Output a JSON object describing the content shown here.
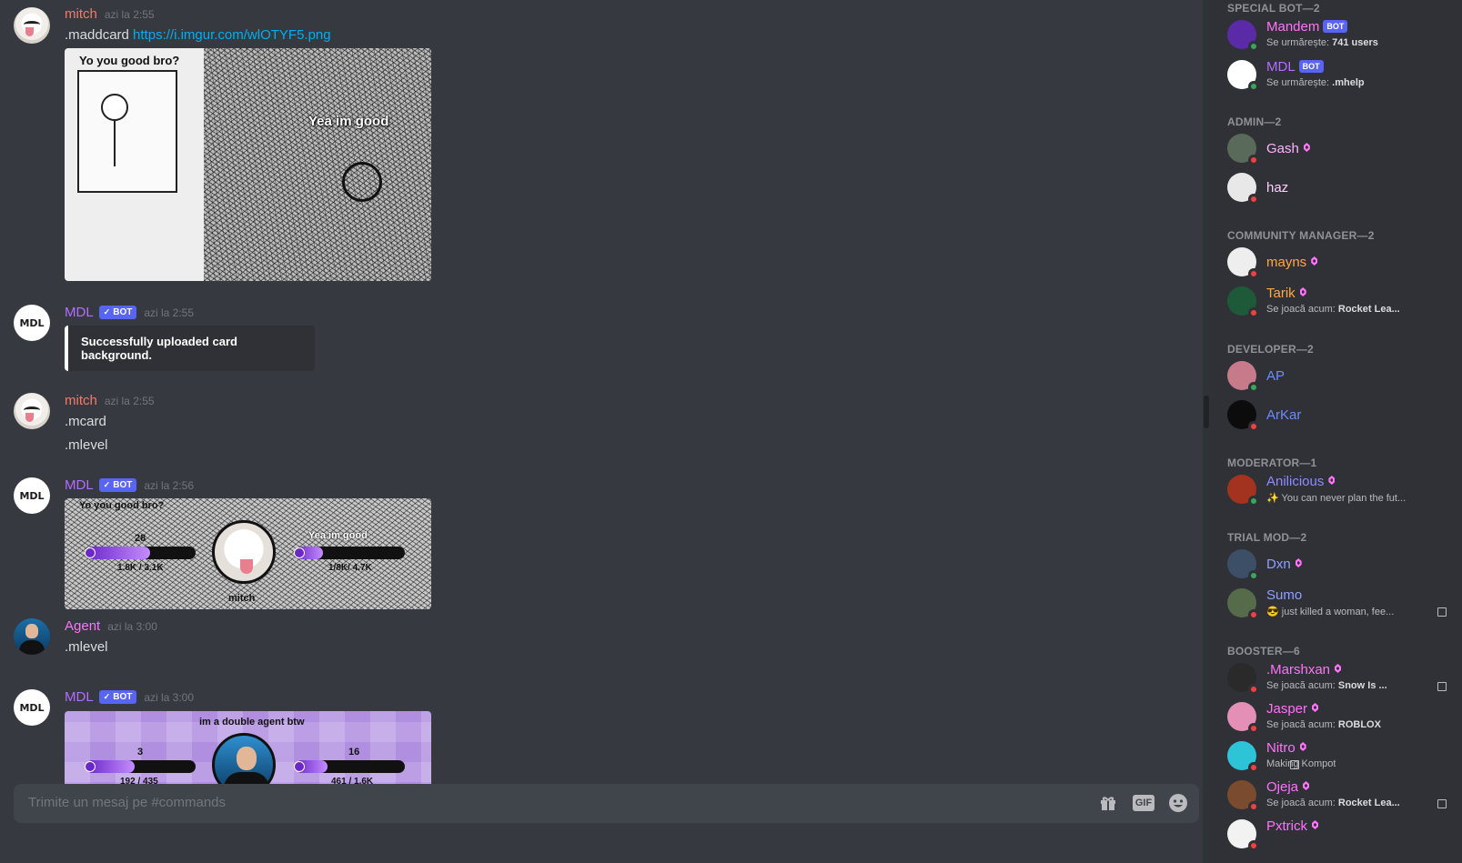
{
  "chat": {
    "messages": [
      {
        "author": "mitch",
        "time": "azi la 2:55",
        "text": ".maddcard",
        "link": "https://i.imgur.com/wlOTYF5.png",
        "image": {
          "caption_top": "Yo you good bro?",
          "caption_right": "Yea im good"
        }
      },
      {
        "author": "MDL",
        "bot_label": "BOT",
        "time": "azi la 2:55",
        "embed": "Successfully uploaded card background."
      },
      {
        "author": "mitch",
        "time": "azi la 2:55",
        "lines": [
          ".mcard",
          ".mlevel"
        ]
      },
      {
        "author": "MDL",
        "bot_label": "BOT",
        "time": "azi la 2:56",
        "card": {
          "top_text": "Yo you good bro?",
          "right_text": "Yea im good",
          "level_left": "28",
          "xp_left": "1.8K / 3.1K",
          "xp_left_fill": 0.58,
          "xp_right_fill": 0.25,
          "xp_right": "1/8K/ 4.7K",
          "name": "mitch"
        }
      },
      {
        "author": "Agent",
        "time": "azi la 3:00",
        "text": ".mlevel"
      },
      {
        "author": "MDL",
        "bot_label": "BOT",
        "time": "azi la 3:00",
        "card": {
          "top_text": "im a double agent btw",
          "level_left": "3",
          "xp_left": "192 / 435",
          "xp_left_fill": 0.44,
          "level_right": "16",
          "xp_right": "461 / 1.6K",
          "xp_right_fill": 0.29
        }
      }
    ],
    "avatar_text": "MDL",
    "input_placeholder": "Trimite un mesaj pe #commands",
    "gif_label": "GIF"
  },
  "members": {
    "sections": [
      {
        "title": "SPECIAL BOT—2"
      },
      {
        "title": "ADMIN—2"
      },
      {
        "title": "COMMUNITY MANAGER—2"
      },
      {
        "title": "DEVELOPER—2"
      },
      {
        "title": "MODERATOR—1"
      },
      {
        "title": "TRIAL MOD—2"
      },
      {
        "title": "BOOSTER—6"
      }
    ],
    "list": [
      {
        "name": "Mandem",
        "bot": "BOT",
        "color": "#ff73fa",
        "sub_prefix": "Se urmărește: ",
        "sub_bold": "741 users",
        "status": "online"
      },
      {
        "name": "MDL",
        "bot": "BOT",
        "color": "#b56cff",
        "sub_prefix": "Se urmărește: ",
        "sub_bold": ".mhelp",
        "status": "online"
      },
      {
        "name": "Gash",
        "color": "#ffb3ff",
        "status": "dnd"
      },
      {
        "name": "haz",
        "color": "#ffcfff",
        "status": "dnd"
      },
      {
        "name": "mayns",
        "color": "#ffa940",
        "status": "dnd"
      },
      {
        "name": "Tarik",
        "color": "#ffa940",
        "sub_prefix": "Se joacă acum: ",
        "sub_bold": "Rocket Lea...",
        "status": "dnd"
      },
      {
        "name": "AP",
        "color": "#6b8cff",
        "status": "online"
      },
      {
        "name": "ArKar",
        "color": "#6b8cff",
        "status": "dnd"
      },
      {
        "name": "Anilicious",
        "color": "#8e8cff",
        "sub_prefix": "✨ You can never plan the fut...",
        "status": "online"
      },
      {
        "name": "Dxn",
        "color": "#8ea0ff",
        "status": "online"
      },
      {
        "name": "Sumo",
        "color": "#8ea0ff",
        "sub_prefix": "😎 just killed a woman, fee...",
        "status": "dnd"
      },
      {
        "name": ".Marshxan",
        "color": "#ff73fa",
        "sub_prefix": "Se joacă acum: ",
        "sub_bold": "Snow Is ...",
        "status": "dnd"
      },
      {
        "name": "Jasper",
        "color": "#ff73fa",
        "sub_prefix": "Se joacă acum: ",
        "sub_bold": "ROBLOX",
        "status": "dnd"
      },
      {
        "name": "Nitro",
        "color": "#ff73fa",
        "sub_prefix": "Making Kompot",
        "status": "dnd"
      },
      {
        "name": "Ojeja",
        "color": "#ff73fa",
        "sub_prefix": "Se joacă acum: ",
        "sub_bold": "Rocket Lea...",
        "status": "dnd"
      },
      {
        "name": "Pxtrick",
        "color": "#ff73fa",
        "status": "dnd"
      }
    ]
  },
  "colors": {
    "mitch": "#f47b67",
    "mdl": "#b56cff",
    "agent": "#ff73fa",
    "link": "#00aff4",
    "bot_tag": "#5865f2"
  }
}
